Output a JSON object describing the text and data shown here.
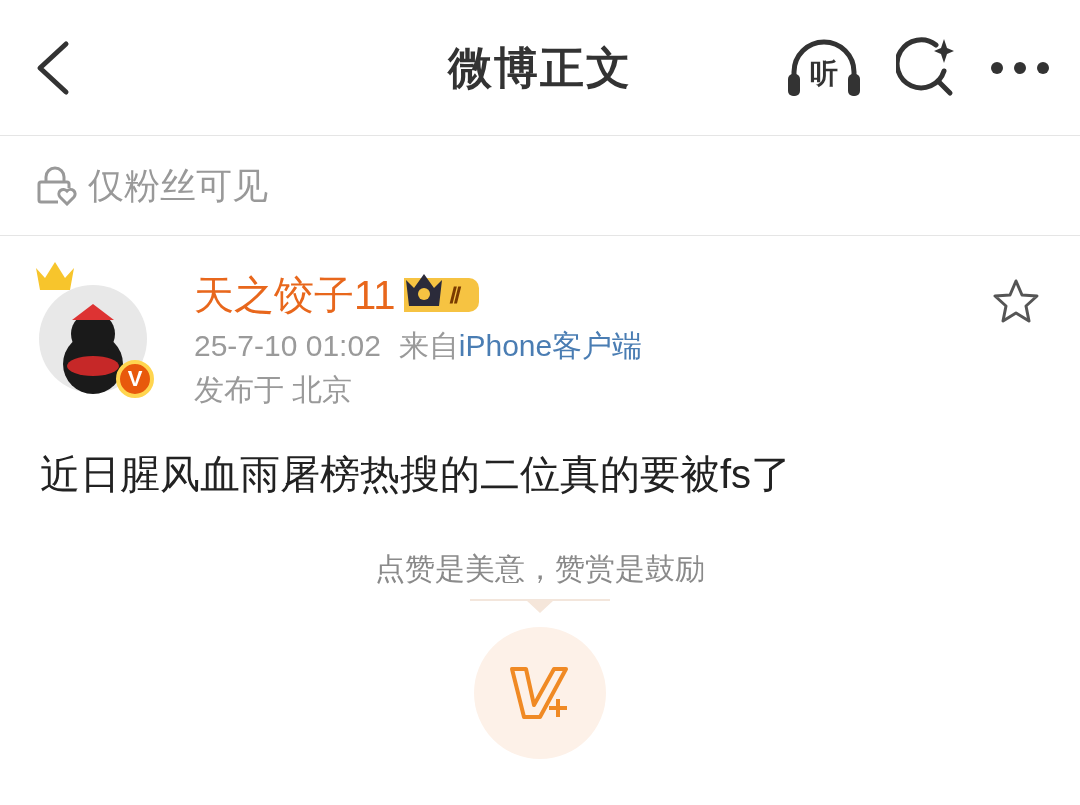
{
  "header": {
    "title": "微博正文",
    "listen_label": "听"
  },
  "visibility": {
    "label": "仅粉丝可见"
  },
  "post": {
    "author": {
      "name": "天之饺子11",
      "level_badge": "Ⅱ",
      "verified_mark": "V",
      "verified": true
    },
    "time": "25-7-10 01:02",
    "source_prefix": "来自",
    "source": "iPhone客户端",
    "location": "发布于 北京",
    "favorited": false,
    "text": "近日腥风血雨屠榜热搜的二位真的要被fs了"
  },
  "reward": {
    "hint": "点赞是美意，赞赏是鼓励"
  }
}
